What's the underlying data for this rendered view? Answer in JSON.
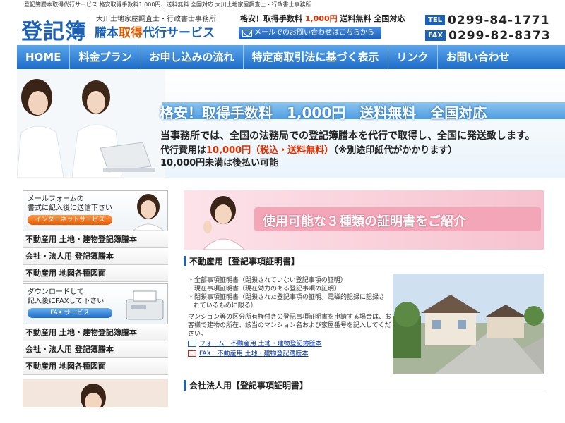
{
  "topline": "登記簿謄本取得代行サービス 格安取得手数料1,000円、送料無料 全国対応 大川土地家屋調査士・行政書士事務所",
  "header": {
    "logo": "登記簿",
    "office": "大川土地家屋調査士・行政書士事務所",
    "tagline_a": "謄本",
    "tagline_b": "取得",
    "tagline_c": "代行サービス",
    "slogan_a": "格安！取得手数料",
    "slogan_price": "1,000円",
    "slogan_b": "送料無料 全国対応",
    "mail_button": "メールでのお問い合わせはこちらから",
    "tel_label": "TEL",
    "tel": "0299-84-1771",
    "fax_label": "FAX",
    "fax": "0299-82-8373"
  },
  "nav": [
    "HOME",
    "料金プラン",
    "お申し込みの流れ",
    "特定商取引法に基づく表示",
    "リンク",
    "お問い合わせ"
  ],
  "hero": {
    "headline": "格安！取得手数料　1,000円　送料無料　全国対応",
    "line1": "当事務所では、全国の法務局での登記簿謄本を代行で取得し、全国に発送致します。",
    "line2_a": "代行費用は",
    "line2_red": "10,000円（税込・送料無料）",
    "line2_b": "（※別途印紙代がかかります）",
    "line3": "10,000円未満は後払い可能"
  },
  "side": {
    "internet_banner": {
      "text1": "メールフォームの",
      "text2": "書式に記入後に送信下さい",
      "pill": "インターネットサービス"
    },
    "links_a": [
      "不動産用 土地・建物登記簿謄本",
      "会社・法人用 登記簿謄本",
      "不動産用 地図各種図面"
    ],
    "fax_banner": {
      "text1": "ダウンロードして",
      "text2": "記入後にFAXして下さい",
      "pill": "FAX サービス"
    },
    "links_b": [
      "不動産用 土地・建物登記簿謄本",
      "会社・法人用 登記簿謄本",
      "不動産用 地図各種図面"
    ]
  },
  "main": {
    "banner_title": "使用可能な３種類の証明書をご紹介",
    "section1": {
      "title": "不動産用【登記事項証明書】",
      "items": [
        "全部事項証明書（閉鎖されていない登記事項の証明）",
        "現在事項証明書（現在効力のある登記事項の証明）",
        "閉鎖事項証明書（閉鎖された登記事項の証明。電磁的記録に記録されているものに限る）"
      ],
      "note": "マンション等の区分所有権付きの登記事項証明書を申請する場合は、お客様で建物の所在、該当のマンション名および家屋番号を記入してください。",
      "link_form": "フォーム　不動産用 土地・建物登記簿謄本",
      "link_fax": "FAX　不動産用 土地・建物登記簿謄本"
    },
    "section2": {
      "title": "会社法人用【登記事項証明書】"
    }
  },
  "colors": {
    "brand": "#1b61b8",
    "accent": "#e03000",
    "nav": "#1e6cc8",
    "pink": "#f2a6b8"
  }
}
